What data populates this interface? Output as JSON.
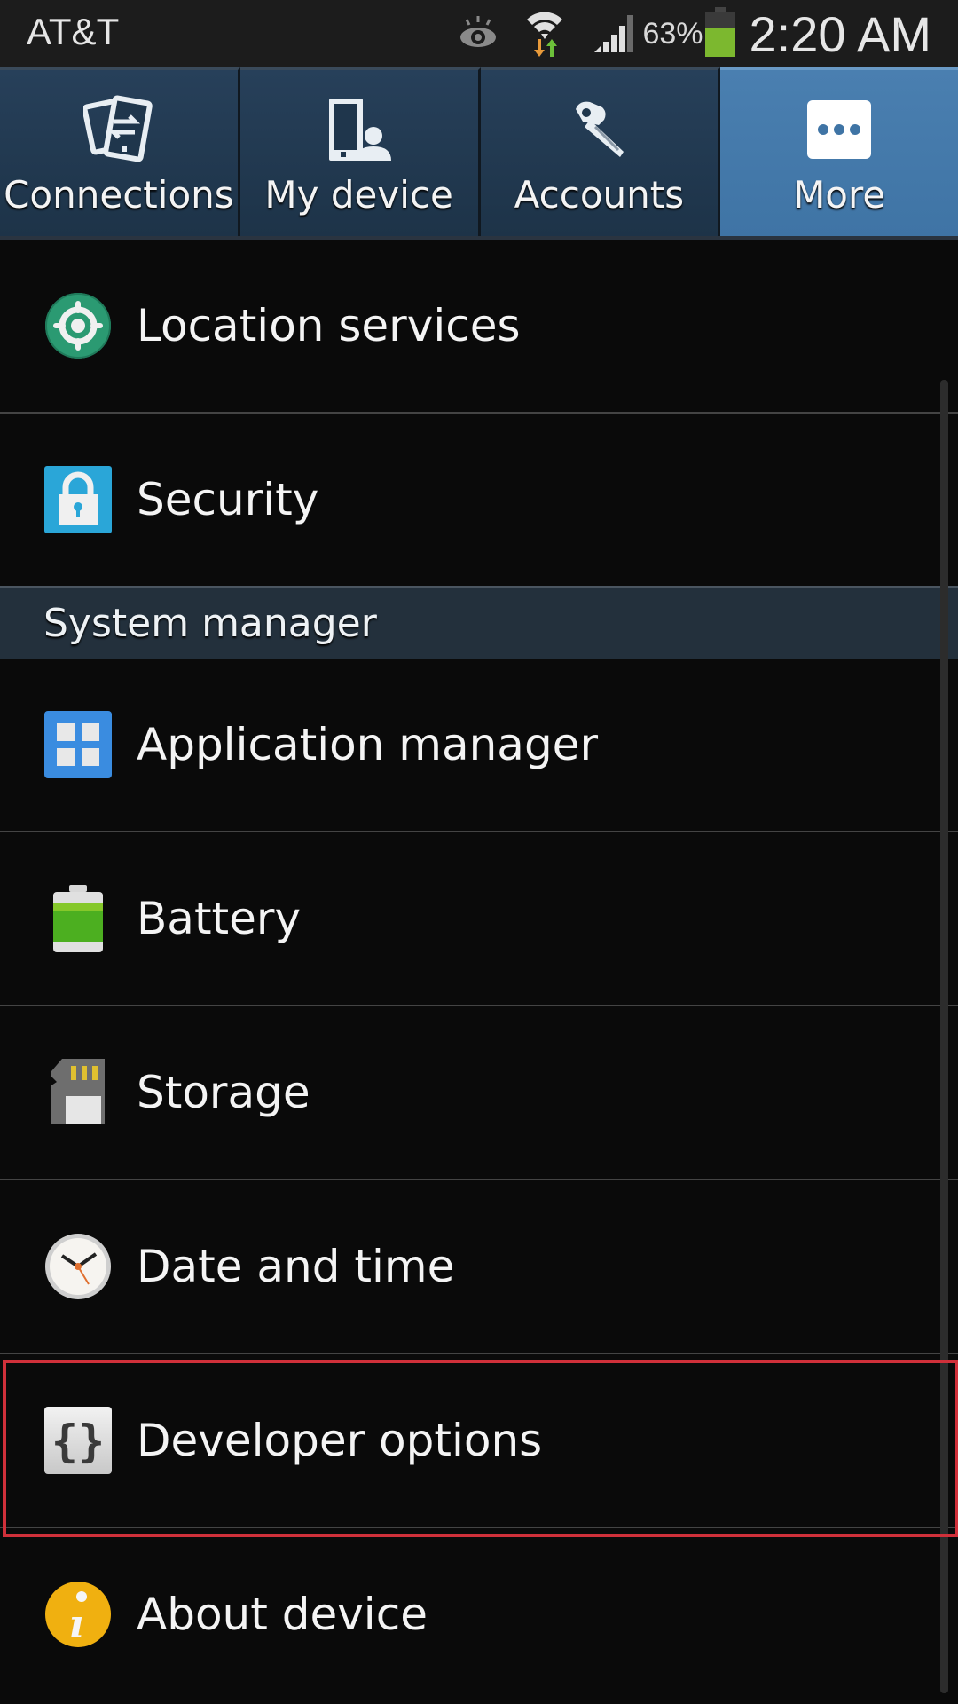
{
  "status_bar": {
    "carrier": "AT&T",
    "icons": [
      "eye-icon",
      "wifi-icon",
      "signal-icon",
      "battery-icon"
    ],
    "battery_percent": "63%",
    "time": "2:20 AM",
    "battery_color": "#7cb82f"
  },
  "tabs": [
    {
      "label": "Connections",
      "icon": "connections-icon",
      "active": false
    },
    {
      "label": "My device",
      "icon": "my-device-icon",
      "active": false
    },
    {
      "label": "Accounts",
      "icon": "key-icon",
      "active": false
    },
    {
      "label": "More",
      "icon": "more-icon",
      "active": true
    }
  ],
  "list": {
    "items_top": [
      {
        "label": "Location services",
        "icon": "location-icon"
      },
      {
        "label": "Security",
        "icon": "lock-icon"
      }
    ],
    "section_header": "System manager",
    "items_system": [
      {
        "label": "Application manager",
        "icon": "app-grid-icon"
      },
      {
        "label": "Battery",
        "icon": "battery-icon"
      },
      {
        "label": "Storage",
        "icon": "sd-card-icon"
      },
      {
        "label": "Date and time",
        "icon": "clock-icon"
      },
      {
        "label": "Developer options",
        "icon": "braces-icon",
        "highlighted": true
      },
      {
        "label": "About device",
        "icon": "info-icon"
      }
    ]
  },
  "colors": {
    "tab_active": "#4578a8",
    "tab_inactive": "#223a50",
    "highlight_border": "#d0303a",
    "section_header_bg": "#23303c"
  }
}
